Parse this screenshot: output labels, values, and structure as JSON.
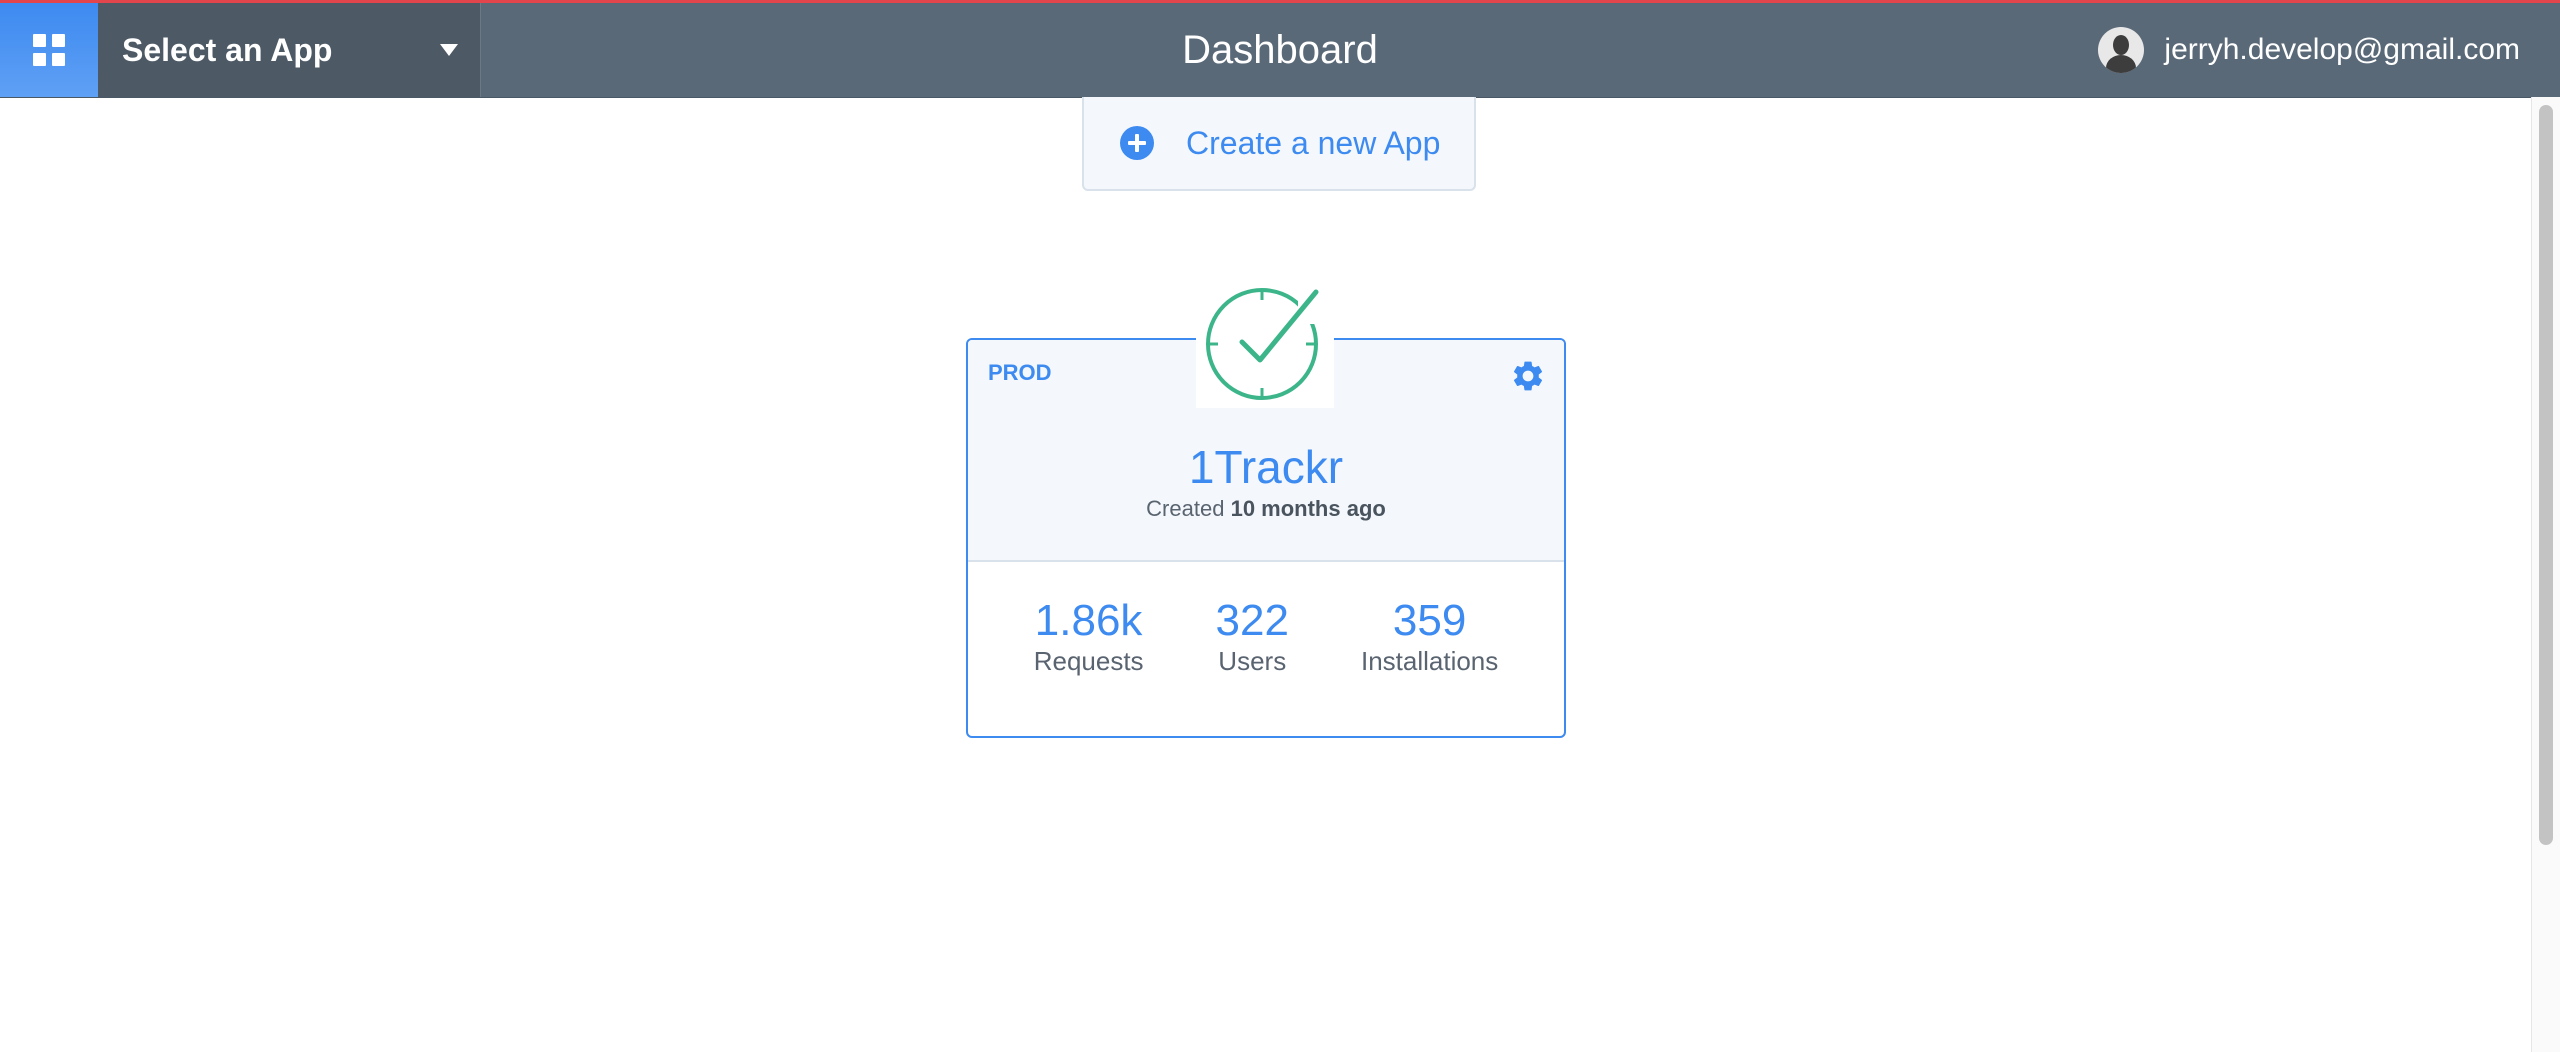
{
  "topbar": {
    "app_selector_label": "Select an App",
    "page_title": "Dashboard",
    "account_email": "jerryh.develop@gmail.com",
    "accent_color": "#e3454c",
    "bar_color": "#5a6978",
    "primary_color": "#3d8af0"
  },
  "create_app": {
    "label": "Create a new App",
    "icon": "plus-circle-icon"
  },
  "app_card": {
    "env_badge": "PROD",
    "icon": "clock-check-icon",
    "settings_icon": "gear-icon",
    "name": "1Trackr",
    "created_prefix": "Created",
    "created_value": "10 months ago",
    "stats": [
      {
        "value": "1.86k",
        "label": "Requests"
      },
      {
        "value": "322",
        "label": "Users"
      },
      {
        "value": "359",
        "label": "Installations"
      }
    ]
  }
}
